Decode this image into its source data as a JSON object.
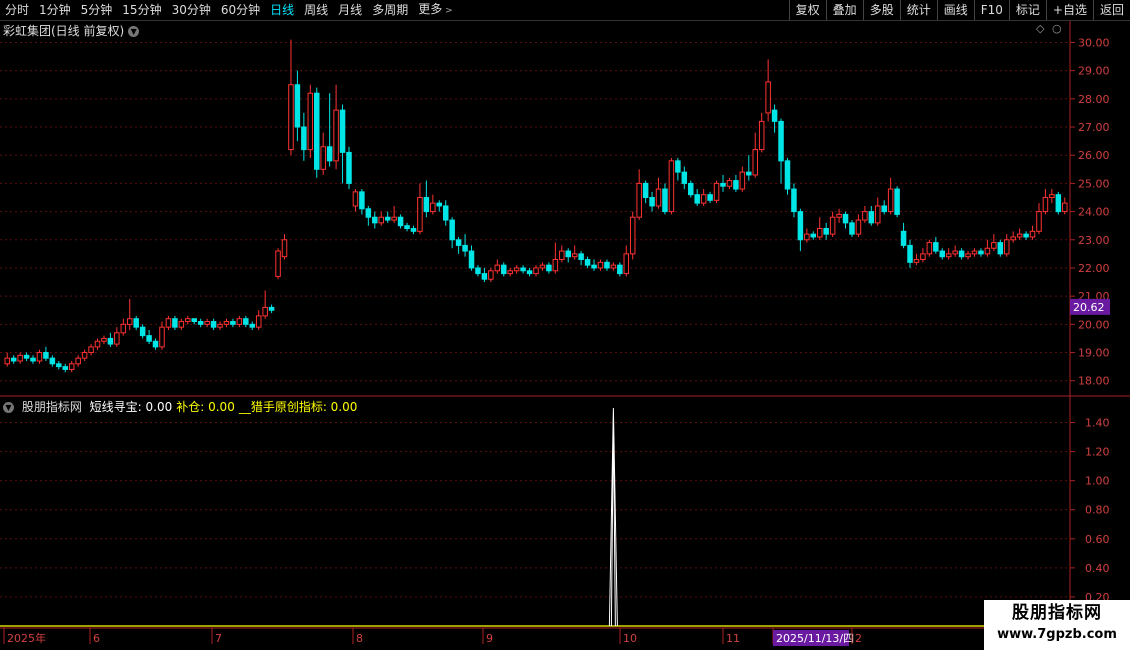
{
  "toolbar": {
    "periods": [
      "分时",
      "1分钟",
      "5分钟",
      "15分钟",
      "30分钟",
      "60分钟",
      "日线",
      "周线",
      "月线",
      "多周期",
      "更多"
    ],
    "active_period": "日线",
    "tools": [
      "复权",
      "叠加",
      "多股",
      "统计",
      "画线",
      "F10",
      "标记",
      "+自选",
      "返回"
    ]
  },
  "main_chart": {
    "title": "彩虹集团(日线 前复权)",
    "current_price": "20.62",
    "y_ticks": [
      "30.00",
      "29.00",
      "28.00",
      "27.00",
      "26.00",
      "25.00",
      "24.00",
      "23.00",
      "22.00",
      "21.00",
      "20.00",
      "19.00",
      "18.00"
    ]
  },
  "indicator": {
    "name": "股朋指标网",
    "fields": [
      {
        "label": "短线寻宝: 0.00",
        "color": "#ffffff"
      },
      {
        "label": "补仓: 0.00",
        "color": "#ffff00"
      },
      {
        "label": "__猎手原创指标: 0.00",
        "color": "#ffff00"
      }
    ],
    "y_ticks": [
      "1.40",
      "1.20",
      "1.00",
      "0.80",
      "0.60",
      "0.40",
      "0.20"
    ]
  },
  "time_axis": {
    "labels": [
      "2025年",
      "6",
      "7",
      "8",
      "9",
      "10",
      "11",
      "2025/11/13/四",
      "2"
    ]
  },
  "watermark": {
    "line1": "股朋指标网",
    "line2": "www.7gpzb.com"
  },
  "chart_data": {
    "type": "candlestick",
    "ylim": [
      17.6,
      30.3
    ],
    "indicator_ylim": [
      0,
      1.5
    ],
    "candles": [
      [
        18.6,
        18.8,
        18.5,
        19.0
      ],
      [
        18.8,
        18.7,
        18.6,
        18.9
      ],
      [
        18.7,
        18.9,
        18.6,
        19.0
      ],
      [
        18.9,
        18.8,
        18.7,
        19.0
      ],
      [
        18.8,
        18.7,
        18.6,
        18.9
      ],
      [
        18.7,
        19.0,
        18.6,
        19.1
      ],
      [
        19.0,
        18.8,
        18.7,
        19.2
      ],
      [
        18.8,
        18.6,
        18.5,
        18.9
      ],
      [
        18.6,
        18.5,
        18.4,
        18.7
      ],
      [
        18.5,
        18.4,
        18.3,
        18.6
      ],
      [
        18.4,
        18.6,
        18.3,
        18.7
      ],
      [
        18.6,
        18.8,
        18.5,
        18.9
      ],
      [
        18.8,
        19.0,
        18.7,
        19.1
      ],
      [
        19.0,
        19.2,
        18.9,
        19.3
      ],
      [
        19.2,
        19.4,
        19.1,
        19.5
      ],
      [
        19.4,
        19.5,
        19.3,
        19.6
      ],
      [
        19.5,
        19.3,
        19.2,
        19.7
      ],
      [
        19.3,
        19.7,
        19.2,
        19.9
      ],
      [
        19.7,
        20.0,
        19.6,
        20.2
      ],
      [
        20.0,
        20.2,
        19.8,
        20.9
      ],
      [
        20.2,
        19.9,
        19.8,
        20.3
      ],
      [
        19.9,
        19.6,
        19.5,
        20.0
      ],
      [
        19.6,
        19.4,
        19.3,
        19.8
      ],
      [
        19.4,
        19.2,
        19.1,
        19.5
      ],
      [
        19.2,
        19.9,
        19.1,
        20.1
      ],
      [
        19.9,
        20.2,
        19.8,
        20.3
      ],
      [
        20.2,
        19.9,
        19.8,
        20.3
      ],
      [
        19.9,
        20.1,
        19.8,
        20.2
      ],
      [
        20.1,
        20.2,
        20.0,
        20.3
      ],
      [
        20.2,
        20.1,
        20.0,
        20.2
      ],
      [
        20.1,
        20.0,
        19.9,
        20.2
      ],
      [
        20.0,
        20.1,
        19.9,
        20.2
      ],
      [
        20.1,
        19.9,
        19.8,
        20.2
      ],
      [
        19.9,
        20.0,
        19.8,
        20.1
      ],
      [
        20.0,
        20.1,
        19.9,
        20.2
      ],
      [
        20.1,
        20.0,
        19.9,
        20.2
      ],
      [
        20.0,
        20.2,
        19.9,
        20.3
      ],
      [
        20.2,
        20.0,
        19.9,
        20.3
      ],
      [
        20.0,
        19.9,
        19.8,
        20.1
      ],
      [
        19.9,
        20.3,
        19.8,
        20.5
      ],
      [
        20.3,
        20.6,
        20.2,
        21.2
      ],
      [
        20.6,
        20.5,
        20.4,
        20.7
      ],
      [
        21.7,
        22.6,
        21.6,
        22.7
      ],
      [
        22.4,
        23.0,
        22.3,
        23.2
      ],
      [
        26.2,
        28.5,
        26.0,
        30.1
      ],
      [
        28.5,
        27.0,
        26.5,
        29.0
      ],
      [
        27.0,
        26.2,
        25.8,
        27.5
      ],
      [
        26.2,
        28.2,
        25.9,
        28.5
      ],
      [
        28.2,
        25.5,
        25.2,
        28.4
      ],
      [
        25.5,
        26.3,
        25.3,
        26.8
      ],
      [
        26.3,
        25.8,
        25.6,
        28.2
      ],
      [
        25.8,
        27.6,
        25.5,
        28.5
      ],
      [
        27.6,
        26.1,
        25.0,
        27.8
      ],
      [
        26.1,
        25.0,
        24.8,
        26.3
      ],
      [
        24.2,
        24.7,
        24.0,
        24.8
      ],
      [
        24.7,
        24.1,
        23.9,
        24.8
      ],
      [
        24.1,
        23.8,
        23.5,
        24.2
      ],
      [
        23.8,
        23.6,
        23.4,
        24.0
      ],
      [
        23.6,
        23.8,
        23.5,
        24.0
      ],
      [
        23.8,
        23.7,
        23.6,
        24.0
      ],
      [
        23.7,
        23.8,
        23.6,
        24.2
      ],
      [
        23.8,
        23.5,
        23.4,
        23.9
      ],
      [
        23.5,
        23.4,
        23.3,
        23.6
      ],
      [
        23.4,
        23.3,
        23.2,
        23.5
      ],
      [
        23.3,
        24.5,
        23.2,
        25.0
      ],
      [
        24.5,
        24.0,
        23.8,
        25.1
      ],
      [
        24.0,
        24.3,
        23.9,
        24.6
      ],
      [
        24.3,
        24.2,
        24.0,
        24.4
      ],
      [
        24.2,
        23.7,
        23.5,
        24.4
      ],
      [
        23.7,
        23.0,
        22.7,
        23.8
      ],
      [
        23.0,
        22.8,
        22.5,
        23.1
      ],
      [
        22.8,
        22.6,
        22.4,
        23.2
      ],
      [
        22.6,
        22.0,
        21.9,
        22.8
      ],
      [
        22.0,
        21.8,
        21.7,
        22.1
      ],
      [
        21.8,
        21.6,
        21.5,
        22.0
      ],
      [
        21.6,
        21.9,
        21.5,
        22.0
      ],
      [
        21.9,
        22.1,
        21.8,
        22.3
      ],
      [
        22.1,
        21.8,
        21.7,
        22.2
      ],
      [
        21.8,
        21.9,
        21.7,
        22.0
      ],
      [
        21.9,
        22.0,
        21.8,
        22.1
      ],
      [
        22.0,
        21.9,
        21.8,
        22.1
      ],
      [
        21.9,
        21.8,
        21.7,
        22.0
      ],
      [
        21.8,
        22.0,
        21.7,
        22.1
      ],
      [
        22.0,
        22.1,
        21.9,
        22.2
      ],
      [
        22.1,
        21.9,
        21.8,
        22.2
      ],
      [
        21.9,
        22.3,
        21.8,
        22.9
      ],
      [
        22.3,
        22.6,
        22.2,
        22.8
      ],
      [
        22.6,
        22.4,
        22.2,
        22.7
      ],
      [
        22.4,
        22.5,
        22.3,
        22.8
      ],
      [
        22.5,
        22.3,
        22.1,
        22.6
      ],
      [
        22.3,
        22.1,
        22.0,
        22.4
      ],
      [
        22.1,
        22.0,
        21.9,
        22.3
      ],
      [
        22.0,
        22.2,
        21.9,
        22.3
      ],
      [
        22.2,
        22.0,
        21.9,
        22.3
      ],
      [
        22.0,
        22.1,
        21.9,
        22.2
      ],
      [
        22.1,
        21.8,
        21.7,
        22.2
      ],
      [
        21.8,
        22.5,
        21.7,
        22.8
      ],
      [
        22.5,
        23.8,
        22.3,
        24.0
      ],
      [
        23.8,
        25.0,
        23.7,
        25.5
      ],
      [
        25.0,
        24.5,
        24.3,
        25.1
      ],
      [
        24.5,
        24.2,
        24.0,
        24.7
      ],
      [
        24.2,
        24.8,
        24.1,
        25.2
      ],
      [
        24.8,
        24.0,
        23.9,
        25.0
      ],
      [
        24.0,
        25.8,
        23.9,
        25.9
      ],
      [
        25.8,
        25.4,
        25.1,
        25.9
      ],
      [
        25.4,
        25.0,
        24.8,
        25.6
      ],
      [
        25.0,
        24.6,
        24.5,
        25.1
      ],
      [
        24.6,
        24.3,
        24.2,
        24.8
      ],
      [
        24.3,
        24.6,
        24.2,
        24.8
      ],
      [
        24.6,
        24.4,
        24.3,
        24.7
      ],
      [
        24.4,
        25.0,
        24.3,
        25.1
      ],
      [
        25.0,
        24.9,
        24.7,
        25.3
      ],
      [
        24.9,
        25.1,
        24.8,
        25.2
      ],
      [
        25.1,
        24.8,
        24.7,
        25.3
      ],
      [
        24.8,
        25.4,
        24.7,
        25.6
      ],
      [
        25.4,
        25.3,
        25.1,
        26.0
      ],
      [
        25.3,
        26.2,
        25.2,
        26.8
      ],
      [
        26.2,
        27.2,
        26.1,
        27.5
      ],
      [
        27.5,
        28.6,
        27.2,
        29.4
      ],
      [
        27.6,
        27.2,
        26.8,
        27.8
      ],
      [
        27.2,
        25.8,
        25.0,
        27.3
      ],
      [
        25.8,
        24.8,
        24.6,
        25.9
      ],
      [
        24.8,
        24.0,
        23.8,
        25.0
      ],
      [
        24.0,
        23.0,
        22.6,
        24.1
      ],
      [
        23.0,
        23.2,
        22.9,
        23.4
      ],
      [
        23.2,
        23.1,
        23.0,
        23.3
      ],
      [
        23.1,
        23.4,
        23.0,
        23.8
      ],
      [
        23.4,
        23.2,
        23.0,
        23.6
      ],
      [
        23.2,
        23.8,
        23.1,
        24.0
      ],
      [
        23.8,
        23.9,
        23.6,
        24.1
      ],
      [
        23.9,
        23.6,
        23.4,
        24.0
      ],
      [
        23.6,
        23.2,
        23.1,
        23.7
      ],
      [
        23.2,
        23.7,
        23.1,
        23.9
      ],
      [
        23.7,
        24.0,
        23.6,
        24.2
      ],
      [
        24.0,
        23.6,
        23.5,
        24.2
      ],
      [
        23.6,
        24.2,
        23.5,
        24.5
      ],
      [
        24.2,
        24.0,
        23.9,
        24.4
      ],
      [
        24.0,
        24.8,
        23.9,
        25.2
      ],
      [
        24.8,
        23.9,
        23.8,
        24.9
      ],
      [
        23.3,
        22.8,
        22.7,
        23.6
      ],
      [
        22.8,
        22.2,
        22.0,
        23.0
      ],
      [
        22.2,
        22.3,
        22.1,
        22.5
      ],
      [
        22.3,
        22.5,
        22.2,
        22.7
      ],
      [
        22.5,
        22.9,
        22.4,
        23.0
      ],
      [
        22.9,
        22.6,
        22.5,
        23.1
      ],
      [
        22.6,
        22.4,
        22.3,
        22.7
      ],
      [
        22.4,
        22.5,
        22.3,
        22.7
      ],
      [
        22.5,
        22.6,
        22.4,
        22.8
      ],
      [
        22.6,
        22.4,
        22.3,
        22.7
      ],
      [
        22.4,
        22.5,
        22.3,
        22.6
      ],
      [
        22.5,
        22.6,
        22.4,
        22.7
      ],
      [
        22.6,
        22.5,
        22.4,
        22.7
      ],
      [
        22.5,
        22.7,
        22.4,
        23.0
      ],
      [
        22.7,
        22.9,
        22.6,
        23.2
      ],
      [
        22.9,
        22.5,
        22.4,
        23.0
      ],
      [
        22.5,
        23.0,
        22.4,
        23.2
      ],
      [
        23.0,
        23.1,
        22.9,
        23.3
      ],
      [
        23.1,
        23.2,
        23.0,
        23.4
      ],
      [
        23.2,
        23.1,
        23.0,
        23.3
      ],
      [
        23.1,
        23.3,
        23.0,
        23.5
      ],
      [
        23.3,
        24.0,
        23.2,
        24.3
      ],
      [
        24.0,
        24.5,
        23.9,
        24.8
      ],
      [
        24.5,
        24.6,
        24.3,
        24.8
      ],
      [
        24.6,
        24.0,
        23.9,
        24.7
      ],
      [
        24.0,
        24.3,
        23.9,
        24.5
      ]
    ],
    "indicator_spike": {
      "index": 94,
      "peak": 1.5
    }
  }
}
